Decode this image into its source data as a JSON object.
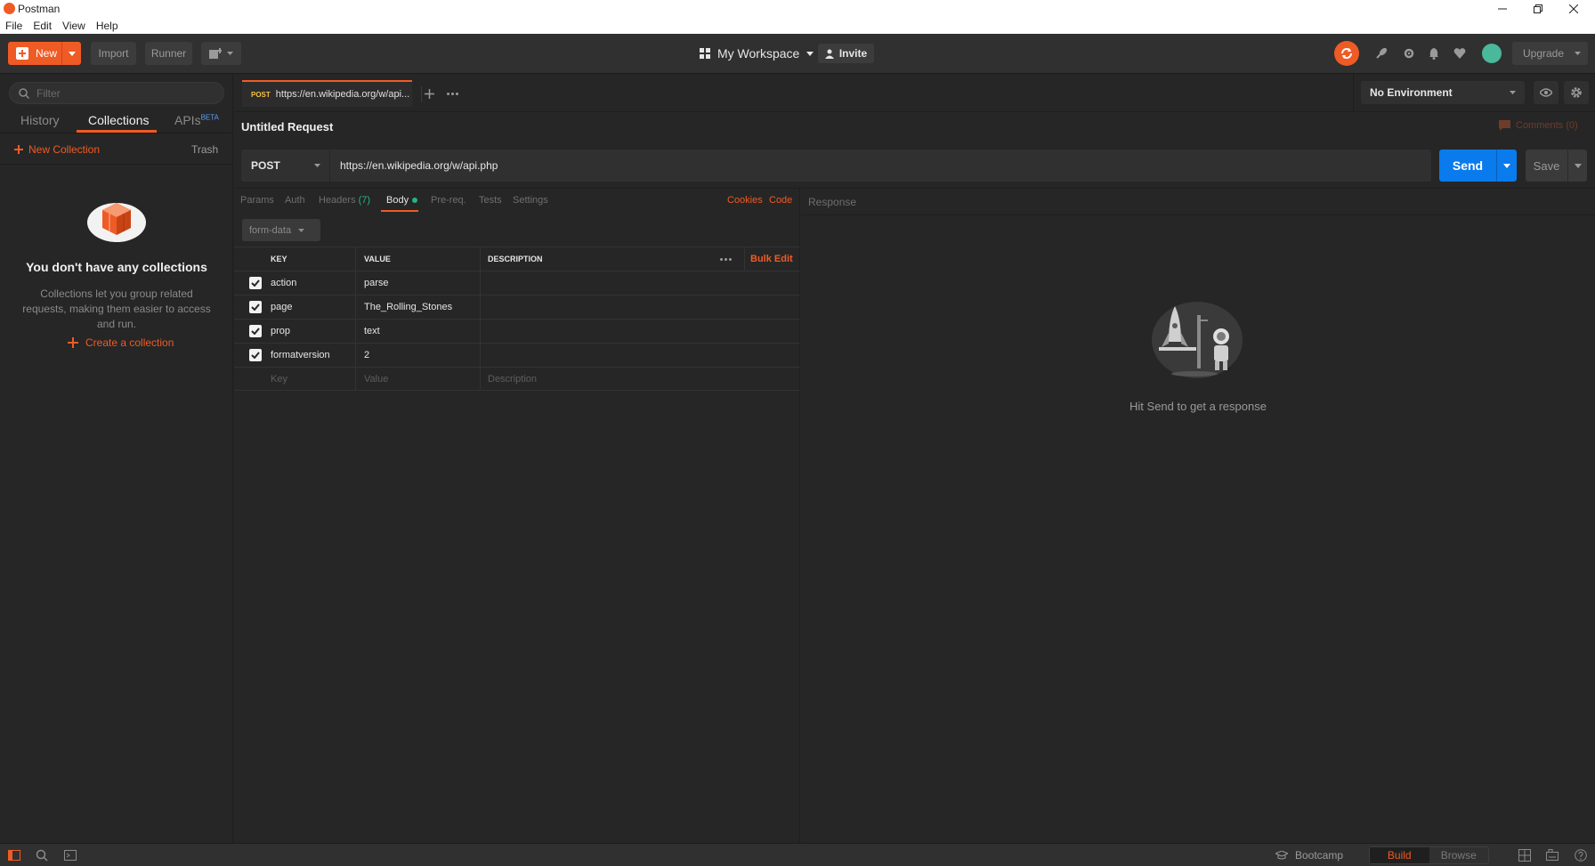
{
  "window": {
    "title": "Postman",
    "menu": [
      "File",
      "Edit",
      "View",
      "Help"
    ]
  },
  "header": {
    "new_label": "New",
    "import_label": "Import",
    "runner_label": "Runner",
    "workspace_label": "My Workspace",
    "invite_label": "Invite",
    "upgrade_label": "Upgrade",
    "accent_color": "#ef5b25"
  },
  "sidebar": {
    "filter_placeholder": "Filter",
    "tabs": {
      "history": "History",
      "collections": "Collections",
      "apis": "APIs",
      "apis_badge": "BETA"
    },
    "new_collection": "New Collection",
    "trash": "Trash",
    "empty_title": "You don't have any collections",
    "empty_desc": "Collections let you group related requests, making them easier to access and run.",
    "create_collection": "Create a collection"
  },
  "request_tab": {
    "method": "POST",
    "title": "https://en.wikipedia.org/w/api..."
  },
  "environment": {
    "selected": "No Environment"
  },
  "request": {
    "name": "Untitled Request",
    "comments": "Comments (0)",
    "method": "POST",
    "url": "https://en.wikipedia.org/w/api.php",
    "send_label": "Send",
    "save_label": "Save",
    "send_color": "#097bed"
  },
  "req_tabs": {
    "params": "Params",
    "auth": "Auth",
    "headers": "Headers",
    "headers_count": "(7)",
    "body": "Body",
    "prereq": "Pre-req.",
    "tests": "Tests",
    "settings": "Settings",
    "cookies": "Cookies",
    "code": "Code"
  },
  "body": {
    "type": "form-data",
    "columns": {
      "key": "KEY",
      "value": "VALUE",
      "description": "DESCRIPTION"
    },
    "bulk_edit": "Bulk Edit",
    "rows": [
      {
        "key": "action",
        "value": "parse",
        "checked": true
      },
      {
        "key": "page",
        "value": "The_Rolling_Stones",
        "checked": true
      },
      {
        "key": "prop",
        "value": "text",
        "checked": true
      },
      {
        "key": "formatversion",
        "value": "2",
        "checked": true
      }
    ],
    "placeholders": {
      "key": "Key",
      "value": "Value",
      "description": "Description"
    }
  },
  "response": {
    "label": "Response",
    "empty": "Hit Send to get a response"
  },
  "footer": {
    "bootcamp": "Bootcamp",
    "build": "Build",
    "browse": "Browse"
  }
}
